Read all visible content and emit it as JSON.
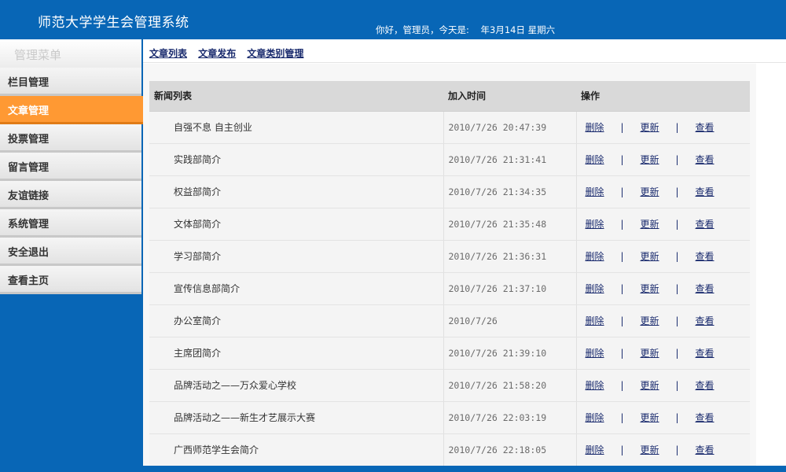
{
  "header": {
    "title": "师范大学学生会管理系统",
    "greeting_prefix": "你好，管理员，今天是:",
    "date_text": "年3月14日 星期六"
  },
  "sidebar": {
    "menu_title": "管理菜单",
    "items": [
      {
        "label": "栏目管理"
      },
      {
        "label": "文章管理"
      },
      {
        "label": "投票管理"
      },
      {
        "label": "留言管理"
      },
      {
        "label": "友谊链接"
      },
      {
        "label": "系统管理"
      },
      {
        "label": "安全退出"
      },
      {
        "label": "查看主页"
      }
    ],
    "active_index": 1
  },
  "tabs": [
    "文章列表",
    "文章发布",
    "文章类别管理"
  ],
  "table": {
    "headers": [
      "新闻列表",
      "加入时间",
      "操作"
    ],
    "actions": {
      "delete": "删除",
      "update": "更新",
      "view": "查看",
      "separator": "|"
    },
    "rows": [
      {
        "title": "自强不息 自主创业",
        "time": "2010/7/26 20:47:39"
      },
      {
        "title": "实践部简介",
        "time": "2010/7/26 21:31:41"
      },
      {
        "title": "权益部简介",
        "time": "2010/7/26 21:34:35"
      },
      {
        "title": "文体部简介",
        "time": "2010/7/26 21:35:48"
      },
      {
        "title": "学习部简介",
        "time": "2010/7/26 21:36:31"
      },
      {
        "title": "宣传信息部简介",
        "time": "2010/7/26 21:37:10"
      },
      {
        "title": "办公室简介",
        "time": "2010/7/26"
      },
      {
        "title": "主席团简介",
        "time": "2010/7/26 21:39:10"
      },
      {
        "title": "品牌活动之——万众爱心学校",
        "time": "2010/7/26 21:58:20"
      },
      {
        "title": "品牌活动之——新生才艺展示大赛",
        "time": "2010/7/26 22:03:19"
      },
      {
        "title": "广西师范学生会简介",
        "time": "2010/7/26 22:18:05"
      }
    ]
  },
  "colors": {
    "brand_blue": "#0866b6",
    "active_orange": "#ff9933",
    "link_navy": "#1a2b6e"
  }
}
